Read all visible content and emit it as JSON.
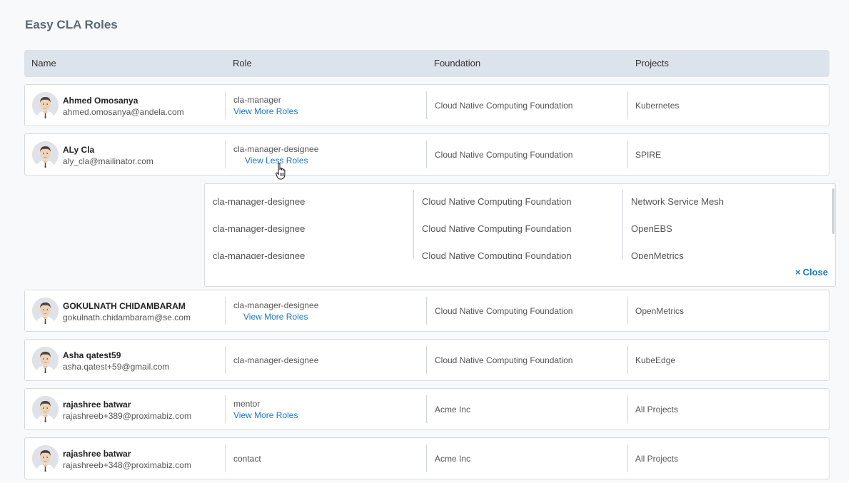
{
  "page": {
    "title": "Easy CLA Roles"
  },
  "table": {
    "headers": {
      "name": "Name",
      "role": "Role",
      "foundation": "Foundation",
      "projects": "Projects"
    },
    "rows": [
      {
        "name": "Ahmed Omosanya",
        "email": "ahmed.omosanya@andela.com",
        "role": "cla-manager",
        "link": "View More Roles",
        "foundation": "Cloud Native Computing Foundation",
        "project": "Kubernetes"
      },
      {
        "name": "ALy Cla",
        "email": "aly_cla@mailinator.com",
        "role": "cla-manager-designee",
        "link": "View Less Roles",
        "foundation": "Cloud Native Computing Foundation",
        "project": "SPIRE"
      },
      {
        "name": "GOKULNATH CHIDAMBARAM",
        "email": "gokulnath.chidambaram@se.com",
        "role": "cla-manager-designee",
        "link": "View More Roles",
        "foundation": "Cloud Native Computing Foundation",
        "project": "OpenMetrics"
      },
      {
        "name": "Asha qatest59",
        "email": "asha.qatest+59@gmail.com",
        "role": "cla-manager-designee",
        "link": "",
        "foundation": "Cloud Native Computing Foundation",
        "project": "KubeEdge"
      },
      {
        "name": "rajashree batwar",
        "email": "rajashreeb+389@proximabiz.com",
        "role": "mentor",
        "link": "View More Roles",
        "foundation": "Acme Inc",
        "project": "All Projects"
      },
      {
        "name": "rajashree batwar",
        "email": "rajashreeb+348@proximabiz.com",
        "role": "contact",
        "link": "",
        "foundation": "Acme Inc",
        "project": "All Projects"
      }
    ]
  },
  "expanded": {
    "rows": [
      {
        "role": "cla-manager-designee",
        "foundation": "Cloud Native Computing Foundation",
        "project": "Network Service Mesh"
      },
      {
        "role": "cla-manager-designee",
        "foundation": "Cloud Native Computing Foundation",
        "project": "OpenEBS"
      },
      {
        "role": "cla-manager-designee",
        "foundation": "Cloud Native Computing Foundation",
        "project": "OpenMetrics"
      }
    ],
    "close_icon": "×",
    "close_label": "Close"
  },
  "icons": {
    "avatar": "avatar-icon",
    "close": "close-icon",
    "cursor": "hand-cursor-icon"
  },
  "colors": {
    "link": "#1a75c7",
    "header_bg": "#dde3ea",
    "title": "#5a6875"
  }
}
